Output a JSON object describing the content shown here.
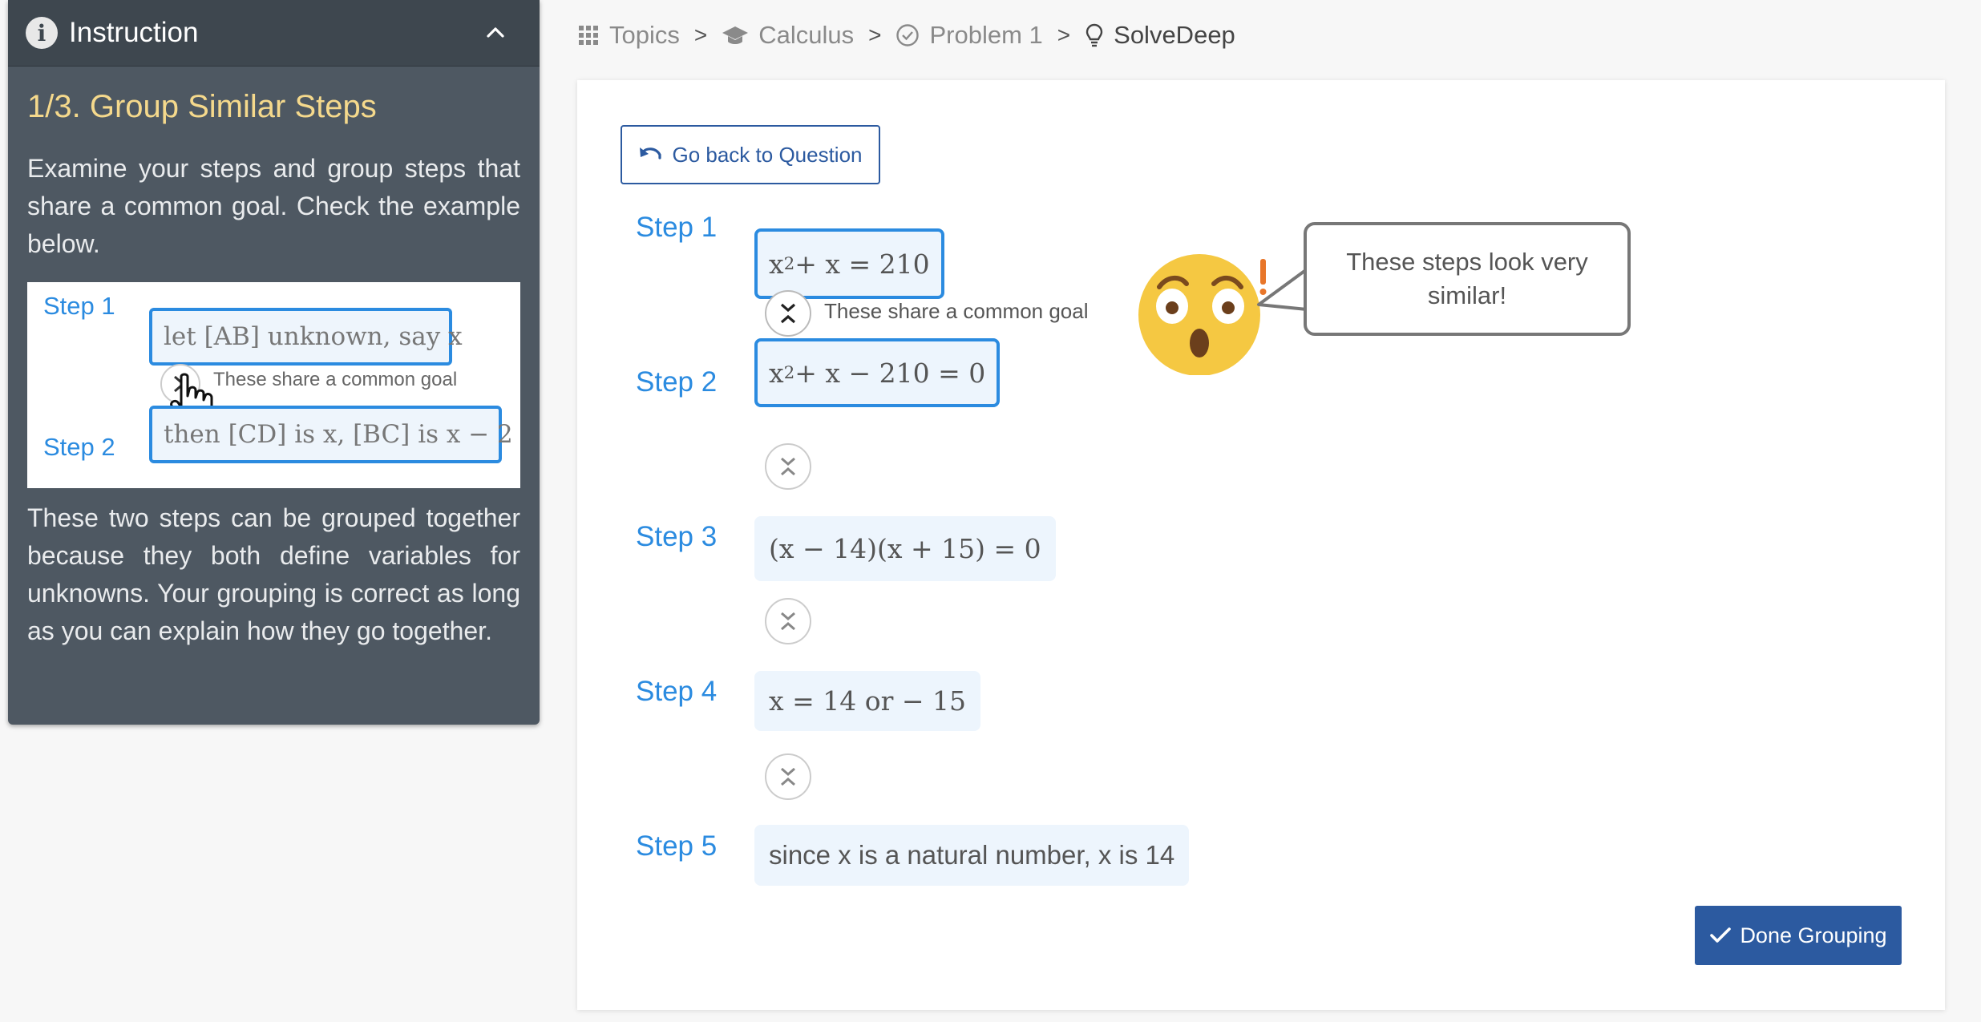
{
  "panel": {
    "header_title": "Instruction",
    "section_title": "1/3. Group Similar Steps",
    "intro_text": "Examine your steps and group steps that share a common goal. Check the example below.",
    "example": {
      "step1_label": "Step 1",
      "step1_text": "let [AB] unknown, say x",
      "note": "These share a common goal",
      "step2_label": "Step 2",
      "step2_text": "then [CD] is x, [BC] is x − 2"
    },
    "explanation_text": "These two steps can be grouped together because they both define variables for unknowns. Your grouping is correct as long as you can explain how they go together."
  },
  "breadcrumb": {
    "topics": "Topics",
    "calculus": "Calculus",
    "problem": "Problem 1",
    "current": "SolveDeep",
    "separator": ">"
  },
  "main": {
    "back_button": "Go back to Question",
    "common_goal_note": "These share a common goal",
    "bubble_text": "These steps look very similar!",
    "done_button": "Done Grouping",
    "steps": [
      {
        "label": "Step 1",
        "base": "x",
        "sup": "2",
        "rest": " + x = 210"
      },
      {
        "label": "Step 2",
        "base": "x",
        "sup": "2",
        "rest": " + x − 210 = 0"
      },
      {
        "label": "Step 3",
        "text": "(x − 14)(x + 15) = 0"
      },
      {
        "label": "Step 4",
        "text": "x = 14 or  − 15"
      },
      {
        "label": "Step 5",
        "text": "since x is a natural number, x is 14"
      }
    ]
  },
  "colors": {
    "accent": "#2b8be0",
    "primary_button": "#2c5aa0",
    "panel_bg": "#4e5862",
    "panel_title": "#f5d98c",
    "step_bg": "#edf5fd"
  }
}
